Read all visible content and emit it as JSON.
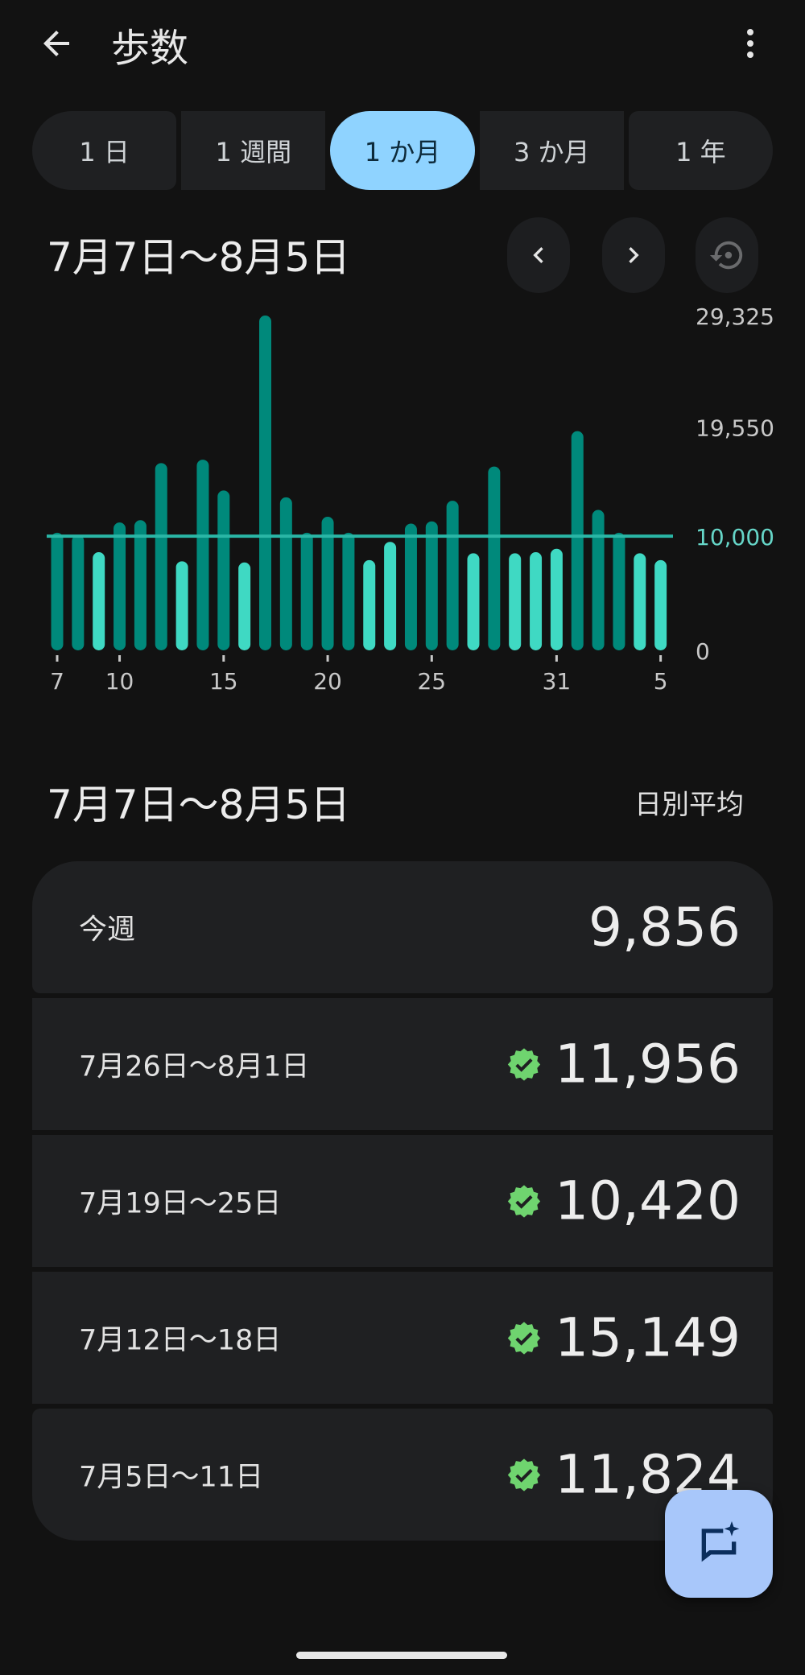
{
  "header": {
    "title": "歩数",
    "back_icon": "arrow-back-icon",
    "more_icon": "more-vert-icon"
  },
  "tabs": [
    {
      "label": "1 日",
      "active": false
    },
    {
      "label": "1 週間",
      "active": false
    },
    {
      "label": "1 か月",
      "active": true
    },
    {
      "label": "3 か月",
      "active": false
    },
    {
      "label": "1 年",
      "active": false
    }
  ],
  "range": {
    "title": "7月7日〜8月5日"
  },
  "chart_data": {
    "type": "bar",
    "days": [
      "7/7",
      "7/8",
      "7/9",
      "7/10",
      "7/11",
      "7/12",
      "7/13",
      "7/14",
      "7/15",
      "7/16",
      "7/17",
      "7/18",
      "7/19",
      "7/20",
      "7/21",
      "7/22",
      "7/23",
      "7/24",
      "7/25",
      "7/26",
      "7/27",
      "7/28",
      "7/29",
      "7/30",
      "7/31",
      "8/1",
      "8/2",
      "8/3",
      "8/4",
      "8/5"
    ],
    "values": [
      10300,
      10100,
      8600,
      11200,
      11400,
      16400,
      7800,
      16700,
      14000,
      7700,
      29325,
      13400,
      10300,
      11700,
      10300,
      7900,
      9500,
      11100,
      11300,
      13100,
      8500,
      16100,
      8500,
      8600,
      8900,
      19200,
      12300,
      10300,
      8500,
      7900
    ],
    "tick_labels": [
      "7",
      "10",
      "15",
      "20",
      "25",
      "31",
      "5"
    ],
    "tick_indices": [
      0,
      3,
      8,
      13,
      18,
      24,
      29
    ],
    "y_ticks": [
      "29,325",
      "19,550",
      "10,000",
      "0"
    ],
    "y_tick_values": [
      29325,
      19550,
      10000,
      0
    ],
    "goal": 10000,
    "ylim": [
      0,
      29325
    ],
    "colors": {
      "bar_dark": "#00897b",
      "bar_light": "#3fd9c3",
      "goal_line": "#2ab6a6",
      "goal_label": "#66d6c8",
      "axis_text": "#c8c8c8"
    }
  },
  "summary": {
    "title": "7月7日〜8月5日",
    "label": "日別平均",
    "weeks": [
      {
        "label": "今週",
        "value": "9,856",
        "goal_met": false
      },
      {
        "label": "7月26日〜8月1日",
        "value": "11,956",
        "goal_met": true
      },
      {
        "label": "7月19日〜25日",
        "value": "10,420",
        "goal_met": true
      },
      {
        "label": "7月12日〜18日",
        "value": "15,149",
        "goal_met": true
      },
      {
        "label": "7月5日〜11日",
        "value": "11,824",
        "goal_met": true
      }
    ]
  },
  "fab": {
    "icon": "ai-chat-icon"
  }
}
